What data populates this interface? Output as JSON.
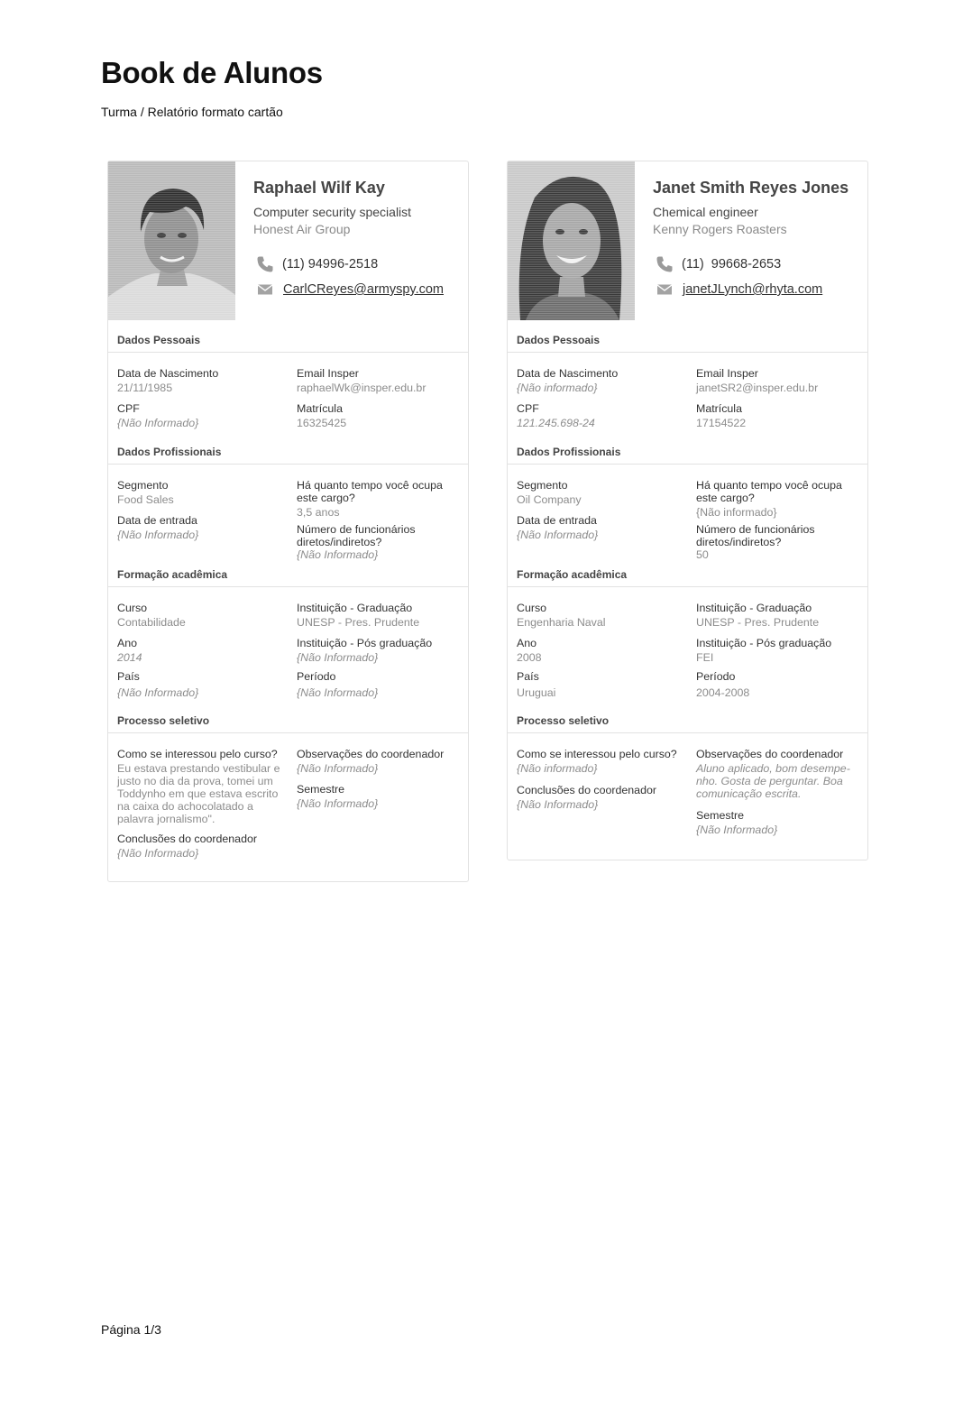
{
  "page": {
    "title": "Book de Alunos",
    "subtitle": "Turma / Relatório formato cartão",
    "footer": "Página 1/3"
  },
  "students": [
    {
      "name": "Raphael Wilf Kay",
      "job": "Computer security specialist",
      "company": "Honest Air Group",
      "phone": "(11) 94996-2518",
      "email": "CarlCReyes@armyspy.com",
      "sections": {
        "pessoais": {
          "title": "Dados Pessoais",
          "nascimento_label": "Data de Nascimento",
          "nascimento": "21/11/1985",
          "email_insper_label": "Email Insper",
          "email_insper": "raphaelWk@insper.edu.br",
          "cpf_label": "CPF",
          "cpf": "{Não Informado}",
          "matricula_label": "Matrícula",
          "matricula": "16325425"
        },
        "profissionais": {
          "title": "Dados Profissionais",
          "segmento_label": "Segmento",
          "segmento": "Food Sales",
          "tempo_label": "Há quanto tempo você ocupa este cargo?",
          "tempo": "3,5 anos",
          "entrada_label": "Data de entrada",
          "entrada": "{Não Informado}",
          "funcionarios_label": "Número de funcionários diretos/indiretos?",
          "funcionarios": "{Não Informado}"
        },
        "formacao": {
          "title": "Formação acadêmica",
          "curso_label": "Curso",
          "curso": "Contabilidade",
          "inst_grad_label": "Instituição - Graduação",
          "inst_grad": "UNESP - Pres. Prudente",
          "ano_label": "Ano",
          "ano": "2014",
          "inst_pos_label": "Instituição - Pós graduação",
          "inst_pos": "{Não Informado}",
          "pais_label": "País",
          "pais": "{Não Informado}",
          "periodo_label": "Período",
          "periodo": "{Não Informado}"
        },
        "processo": {
          "title": "Processo seletivo",
          "interesse_label": "Como se interessou pelo curso?",
          "interesse": "Eu estava prestando vestibular e justo no dia da prova, tomei um Toddynho em que estava escrito na caixa do achocolatado a palavra jornalismo\".",
          "observacoes_label": "Observações do coordenador",
          "observacoes": "{Não Informado}",
          "semestre_label": "Semestre",
          "semestre": "{Não Informado}",
          "conclusoes_label": "Conclusões do coordenador",
          "conclusoes": "{Não Informado}"
        }
      }
    },
    {
      "name": "Janet Smith Reyes Jones",
      "job": "Chemical engineer",
      "company": "Kenny Rogers Roasters",
      "phone": "(11)  99668-2653",
      "email": "janetJLynch@rhyta.com",
      "sections": {
        "pessoais": {
          "title": "Dados Pessoais",
          "nascimento_label": "Data de Nascimento",
          "nascimento": "{Não informado}",
          "email_insper_label": "Email Insper",
          "email_insper": "janetSR2@insper.edu.br",
          "cpf_label": "CPF",
          "cpf": "121.245.698-24",
          "matricula_label": "Matrícula",
          "matricula": "17154522"
        },
        "profissionais": {
          "title": "Dados Profissionais",
          "segmento_label": "Segmento",
          "segmento": "Oil Company",
          "tempo_label": "Há quanto tempo você ocupa este cargo?",
          "tempo": "{Não informado}",
          "entrada_label": "Data de entrada",
          "entrada": "{Não Informado}",
          "funcionarios_label": "Número de funcionários diretos/indiretos?",
          "funcionarios": "50"
        },
        "formacao": {
          "title": "Formação acadêmica",
          "curso_label": "Curso",
          "curso": "Engenharia Naval",
          "inst_grad_label": "Instituição - Graduação",
          "inst_grad": "UNESP - Pres. Prudente",
          "ano_label": "Ano",
          "ano": "2008",
          "inst_pos_label": "Instituição - Pós graduação",
          "inst_pos": "FEI",
          "pais_label": "País",
          "pais": "Uruguai",
          "periodo_label": "Período",
          "periodo": "2004-2008"
        },
        "processo": {
          "title": "Processo seletivo",
          "interesse_label": "Como se interessou pelo curso?",
          "interesse": "{Não informado}",
          "observacoes_label": "Observações do coordenador",
          "observacoes": "Aluno aplicado, bom desempe-nho. Gosta de perguntar. Boa comunicação escrita.",
          "conclusoes_label": "Conclusões do coordenador",
          "conclusoes": "{Não Informado}",
          "semestre_label": "Semestre",
          "semestre": "{Não Informado}"
        }
      }
    }
  ],
  "icons": {
    "phone": "phone-icon",
    "mail": "mail-icon",
    "photo": "profile-photo"
  },
  "colors": {
    "label": "#333333",
    "value": "#8c8c8c",
    "border": "#e2e2e2",
    "icon": "#9a9a9a"
  }
}
